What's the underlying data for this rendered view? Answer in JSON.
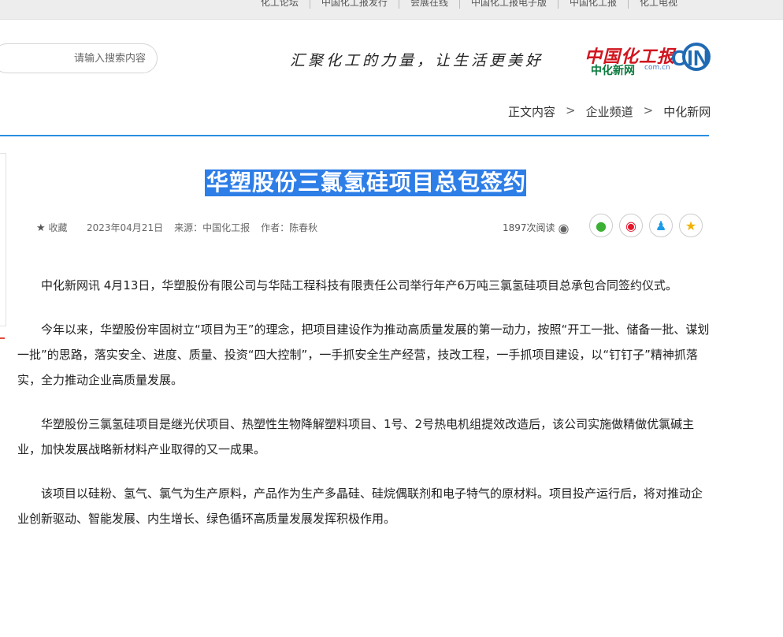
{
  "topbar": {
    "links": [
      "化工电视",
      "中国化工报",
      "中国化工报电子版",
      "会展在线",
      "中国化工报发行",
      "化工论坛"
    ]
  },
  "header": {
    "logo_script": "中国化工报",
    "logo_cn": "中化新网",
    "logo_domain": "com.cn",
    "logo_badge": "CIN",
    "slogan": "汇聚化工的力量，让生活更美好",
    "search_placeholder": "请输入搜索内容"
  },
  "breadcrumb": [
    "中化新网",
    ">",
    "企业频道",
    ">",
    "正文内容"
  ],
  "article": {
    "title": "华塑股份三氯氢硅项目总包签约",
    "views": "1897次阅读",
    "author": "作者：陈春秋",
    "source": "来源：中国化工报",
    "date": "2023年04月21日",
    "collect": "收藏",
    "paragraphs": [
      "中化新网讯 4月13日，华塑股份有限公司与华陆工程科技有限责任公司举行年产6万吨三氯氢硅项目总承包合同签约仪式。",
      "今年以来，华塑股份牢固树立“项目为王”的理念，把项目建设作为推动高质量发展的第一动力，按照“开工一批、储备一批、谋划一批”的思路，落实安全、进度、质量、投资“四大控制”，一手抓安全生产经营，技改工程，一手抓项目建设，以“钉钉子”精神抓落实，全力推动企业高质量发展。",
      "华塑股份三氯氢硅项目是继光伏项目、热塑性生物降解塑料项目、1号、2号热电机组提效改造后，该公司实施做精做优氯碱主业，加快发展战略新材料产业取得的又一成果。",
      "该项目以硅粉、氢气、氯气为生产原料，产品作为生产多晶硅、硅烷偶联剂和电子特气的原材料。项目投产运行后，将对推动企业创新驱动、智能发展、内生增长、绿色循环高质量发展发挥积极作用。"
    ]
  },
  "share": [
    "star-icon",
    "qq-icon",
    "weibo-icon",
    "wechat-icon"
  ]
}
